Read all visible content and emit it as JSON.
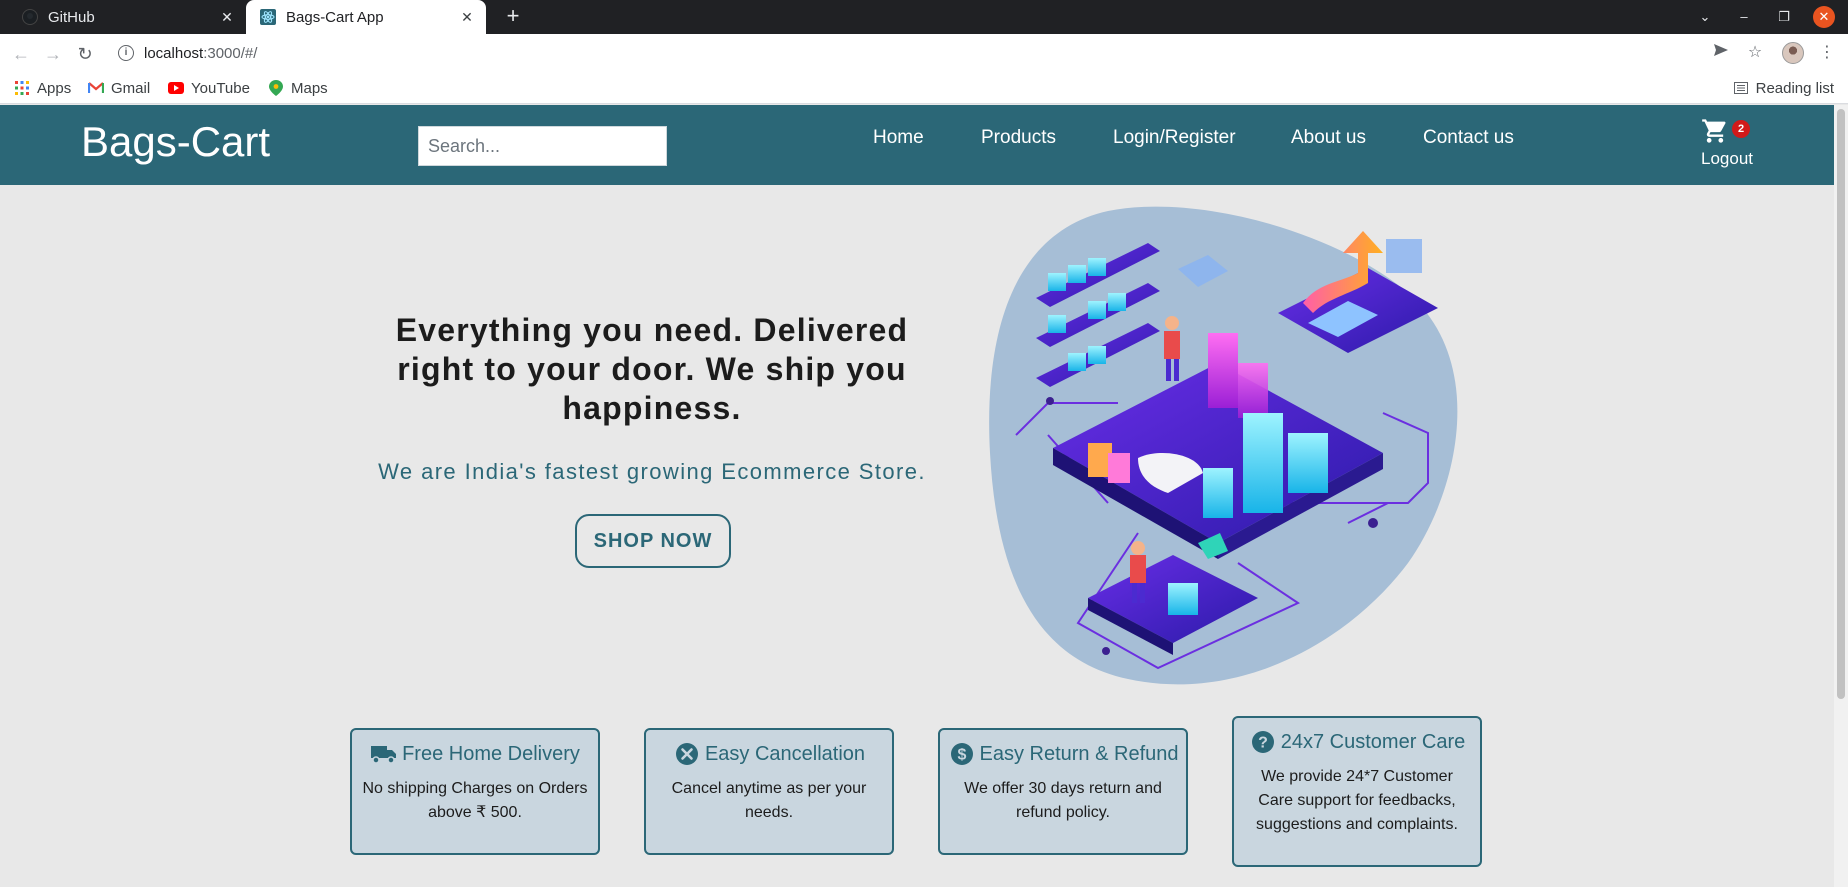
{
  "browser": {
    "tabs": [
      {
        "title": "GitHub",
        "active": false
      },
      {
        "title": "Bags-Cart App",
        "active": true
      }
    ],
    "url_host": "localhost",
    "url_rest": ":3000/#/",
    "bookmarks": [
      "Apps",
      "Gmail",
      "YouTube",
      "Maps"
    ],
    "reading_list": "Reading list"
  },
  "site": {
    "brand": "Bags-Cart",
    "search_placeholder": "Search...",
    "nav": [
      "Home",
      "Products",
      "Login/Register",
      "About us",
      "Contact us"
    ],
    "cart_count": "2",
    "logout": "Logout"
  },
  "hero": {
    "title": "Everything you need. Delivered right to your door. We ship you happiness.",
    "subtitle": "We are India's fastest growing Ecommerce Store.",
    "cta": "SHOP NOW"
  },
  "features": [
    {
      "title": "Free Home Delivery",
      "icon": "truck-icon",
      "text": "No shipping Charges on Orders above ₹ 500."
    },
    {
      "title": "Easy Cancellation",
      "icon": "cancel-circle-icon",
      "text": "Cancel anytime as per your needs."
    },
    {
      "title": "Easy Return & Refund",
      "icon": "dollar-circle-icon",
      "text": "We offer 30 days return and refund policy."
    },
    {
      "title": "24x7 Customer Care",
      "icon": "question-circle-icon",
      "text": "We provide 24*7 Customer Care support for feedbacks, suggestions and complaints."
    }
  ],
  "colors": {
    "primary": "#2b6777",
    "card_bg": "#c9d6df",
    "page_bg": "#e8e8e8",
    "badge": "#d11a1a"
  }
}
